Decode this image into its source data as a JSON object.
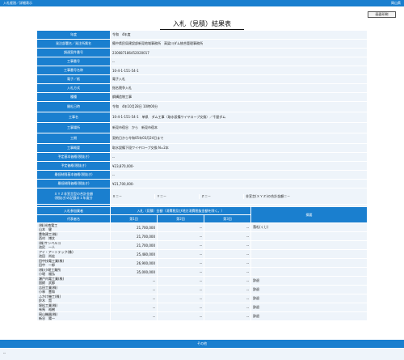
{
  "topbar": {
    "left": "入札経過／詳細表示",
    "right": "岡山県"
  },
  "print_button": "画面印刷",
  "title": "入札（見積）結果表",
  "info_rows": [
    {
      "label": "年度",
      "value": "令和　4年度",
      "h": 11
    },
    {
      "label": "発注部署名／発注所属名",
      "value": "備中県民局建設部新見地域事務所　高梁川ダム統合管理事務所",
      "h": 11
    },
    {
      "label": "調達案件番号",
      "value": "230087186452020017",
      "h": 11
    },
    {
      "label": "工事番号",
      "value": "--",
      "h": 11
    },
    {
      "label": "工事番号名称",
      "value": "10-4-1-151-54-1",
      "h": 11
    },
    {
      "label": "電子／紙",
      "value": "電子入札",
      "h": 11
    },
    {
      "label": "入札方式",
      "value": "指名競争入札",
      "h": 11
    },
    {
      "label": "種種",
      "value": "鋼構造物工事",
      "h": 11
    },
    {
      "label": "開札日時",
      "value": "令和　4年10月28日 10時00分",
      "h": 13
    },
    {
      "label": "工事名",
      "value": "10-4-1-151-54-1　单県　ダム工事（取水設備ワイヤロープ交換）／千屋ダム",
      "h": 13
    },
    {
      "label": "工事場所",
      "value": "新見市宿谷　から　新見市宿本",
      "h": 13
    },
    {
      "label": "工期",
      "value": "契約日から令和05年03月24日まで",
      "h": 13
    },
    {
      "label": "工事概要",
      "value": "取水設備下段ワイヤロープ交換 N=2本",
      "h": 11
    },
    {
      "label": "予定基本価格(税抜き)",
      "value": "--",
      "h": 11
    },
    {
      "label": "予定価格(税抜き)",
      "value": "¥23,870,000-",
      "h": 11
    },
    {
      "label": "最低制限基本価格(税抜き)",
      "value": "--",
      "h": 11
    },
    {
      "label": "最低制限価格(税抜き)",
      "value": "¥21,700,000-",
      "h": 11
    }
  ],
  "score_row": {
    "label1": "ＸＹＺ非宣言型の合計金額",
    "label2": "(税抜き)の記載の１年度分",
    "cells": [
      "Ｘ＝－",
      "Ｙ＝－",
      "Ｚ＝－",
      "非宣言(ＸＹＺ)の合計金額＝－"
    ]
  },
  "remarks_row": {
    "label": "摘要",
    "value": "落札"
  },
  "bids": {
    "head_group": "入札参加業者",
    "head_amount": "入札（見積）金額（消費税及び地方消費税抜金額を除く。）",
    "head_note": "摘要",
    "col_name": "代表者名",
    "col_round1": "第1回",
    "col_round2": "第2回",
    "col_round3": "第3回",
    "rows": [
      {
        "name": "(株)光南電工\n山本　健",
        "r1": "21,700,000",
        "r2": "--",
        "r3": "--",
        "note": "落札(くじ)"
      },
      {
        "name": "豊和建工(株)\n西村　博文",
        "r1": "21,700,000",
        "r2": "--",
        "r3": "--",
        "note": ""
      },
      {
        "name": "(株)サンペルコ\n池尻　一人",
        "r1": "21,700,000",
        "r2": "--",
        "r3": "--",
        "note": ""
      },
      {
        "name": "アイ・アートテック(株)\n池田　尚宏",
        "r1": "25,480,000",
        "r2": "--",
        "r3": "--",
        "note": ""
      },
      {
        "name": "田中技電工業(株)\n田中　一郎",
        "r1": "26,900,000",
        "r2": "--",
        "r3": "--",
        "note": ""
      },
      {
        "name": "(株)小堀工業所\n小堀　福弘",
        "r1": "35,000,000",
        "r2": "--",
        "r3": "--",
        "note": ""
      },
      {
        "name": "瀬戸内電工業(株)\n国締　武都",
        "r1": "--",
        "r2": "--",
        "r3": "--",
        "note": "辞退"
      },
      {
        "name": "吉田工業(株)\n小林　豊和",
        "r1": "--",
        "r2": "--",
        "r3": "--",
        "note": "辞退"
      },
      {
        "name": "ふかけ機工(株)\n鈴木　賢",
        "r1": "--",
        "r2": "--",
        "r3": "--",
        "note": "辞退"
      },
      {
        "name": "堀松工業(株)\n有馬　裕樹",
        "r1": "--",
        "r2": "--",
        "r3": "--",
        "note": "辞退"
      },
      {
        "name": "岡山機器(株)\n新谷　陽一",
        "r1": "--",
        "r2": "--",
        "r3": "--",
        "note": "辞退"
      }
    ]
  },
  "other": {
    "head": "その他",
    "value": "--"
  }
}
